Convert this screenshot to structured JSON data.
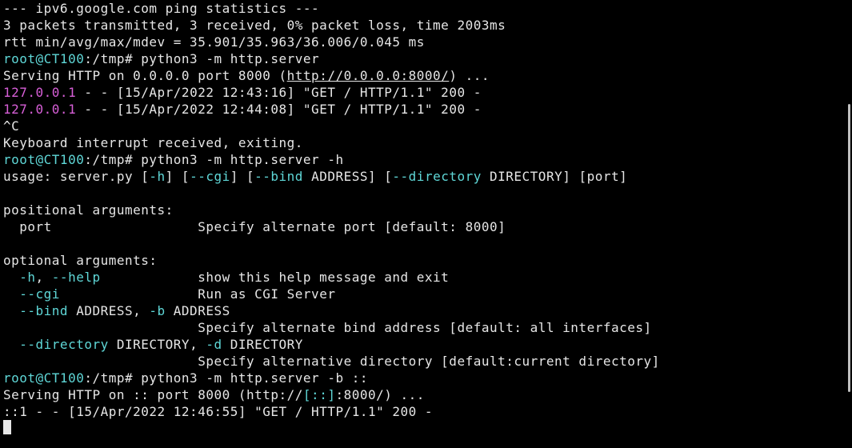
{
  "ping_stats_header": "--- ipv6.google.com ping statistics ---",
  "ping_stats_summary": "3 packets transmitted, 3 received, 0% packet loss, time 2003ms",
  "ping_rtt": "rtt min/avg/max/mdev = 35.901/35.963/36.006/0.045 ms",
  "prompt_user": "root@CT100",
  "prompt_path": ":/tmp#",
  "cmd1": " python3 -m http.server",
  "serving1_pre": "Serving HTTP on 0.0.0.0 port 8000 (",
  "serving1_url": "http://0.0.0.0:8000/",
  "serving1_post": ") ...",
  "client_ip": "127.0.0.1",
  "log1_rest": " - - [15/Apr/2022 12:43:16] \"GET / HTTP/1.1\" 200 -",
  "log2_rest": " - - [15/Apr/2022 12:44:08] \"GET / HTTP/1.1\" 200 -",
  "ctrl_c": "^C",
  "kbd_int": "Keyboard interrupt received, exiting.",
  "cmd2": " python3 -m http.server -h",
  "usage_pre": "usage: server.py [",
  "usage_h": "-h",
  "usage_mid1": "] [",
  "usage_cgi": "--cgi",
  "usage_mid2": "] [",
  "usage_bind": "--bind",
  "usage_bind_arg": " ADDRESS] [",
  "usage_dir": "--directory",
  "usage_dir_arg": " DIRECTORY] [port]",
  "posargs_hdr": "positional arguments:",
  "posargs_line": "  port                  Specify alternate port [default: 8000]",
  "optargs_hdr": "optional arguments:",
  "opt_h_short": "-h",
  "opt_h_sep": ", ",
  "opt_h_long": "--help",
  "opt_h_desc": "            show this help message and exit",
  "opt_cgi": "--cgi",
  "opt_cgi_desc": "                 Run as CGI Server",
  "opt_bind": "--bind",
  "opt_bind_arg": " ADDRESS, ",
  "opt_bind_short": "-b",
  "opt_bind_arg2": " ADDRESS",
  "opt_bind_desc": "                        Specify alternate bind address [default: all interfaces]",
  "opt_dir": "--directory",
  "opt_dir_arg": " DIRECTORY, ",
  "opt_dir_short": "-d",
  "opt_dir_arg2": " DIRECTORY",
  "opt_dir_desc": "                        Specify alternative directory [default:current directory]",
  "cmd3": " python3 -m http.server -b ::",
  "serving2_pre": "Serving HTTP on :: port 8000 (http://",
  "serving2_host": "[::]",
  "serving2_post": ":8000/) ...",
  "log3": "::1 - - [15/Apr/2022 12:46:55] \"GET / HTTP/1.1\" 200 -"
}
